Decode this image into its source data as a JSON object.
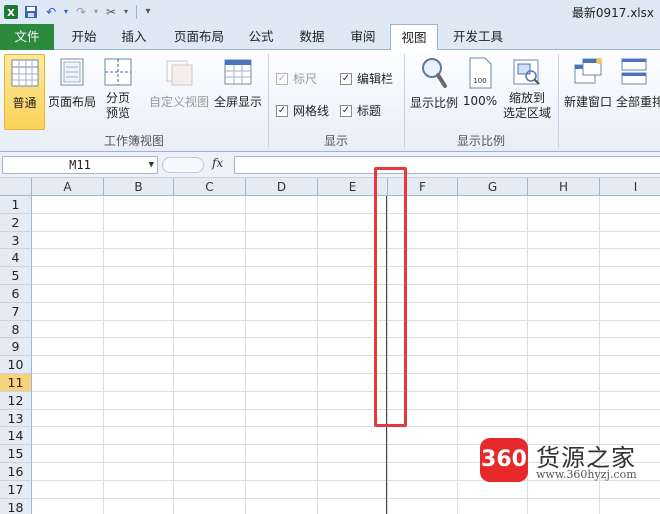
{
  "window": {
    "title": "最新0917.xlsx"
  },
  "tabs": [
    {
      "label": "文件"
    },
    {
      "label": "开始"
    },
    {
      "label": "插入"
    },
    {
      "label": "页面布局"
    },
    {
      "label": "公式"
    },
    {
      "label": "数据"
    },
    {
      "label": "审阅"
    },
    {
      "label": "视图"
    },
    {
      "label": "开发工具"
    }
  ],
  "ribbon": {
    "workbook_views": {
      "group_label": "工作簿视图",
      "normal": "普通",
      "page_layout": "页面布局",
      "page_break_1": "分页",
      "page_break_2": "预览",
      "custom_views": "自定义视图",
      "full_screen": "全屏显示"
    },
    "show": {
      "group_label": "显示",
      "ruler": "标尺",
      "formula_bar": "编辑栏",
      "gridlines": "网格线",
      "headings": "标题"
    },
    "zoom": {
      "group_label": "显示比例",
      "zoom": "显示比例",
      "hundred": "100%",
      "zoom_sel_1": "缩放到",
      "zoom_sel_2": "选定区域"
    },
    "window": {
      "new_window": "新建窗口",
      "arrange_all": "全部重排"
    }
  },
  "formula_bar": {
    "name_box": "M11",
    "fx": "fx"
  },
  "grid": {
    "columns": [
      "A",
      "B",
      "C",
      "D",
      "E",
      "F",
      "G",
      "H",
      "I"
    ],
    "rows": [
      "1",
      "2",
      "3",
      "4",
      "5",
      "6",
      "7",
      "8",
      "9",
      "10",
      "11",
      "12",
      "13",
      "14",
      "15",
      "16",
      "17",
      "18"
    ],
    "selected_row": "11"
  },
  "watermark": {
    "badge": "360",
    "name": "货源之家",
    "url": "www.360hyzj.com"
  },
  "colors": {
    "file_tab": "#2c8a3e",
    "highlight_box": "#e63a3a",
    "selected_header": "#f7d27a"
  }
}
